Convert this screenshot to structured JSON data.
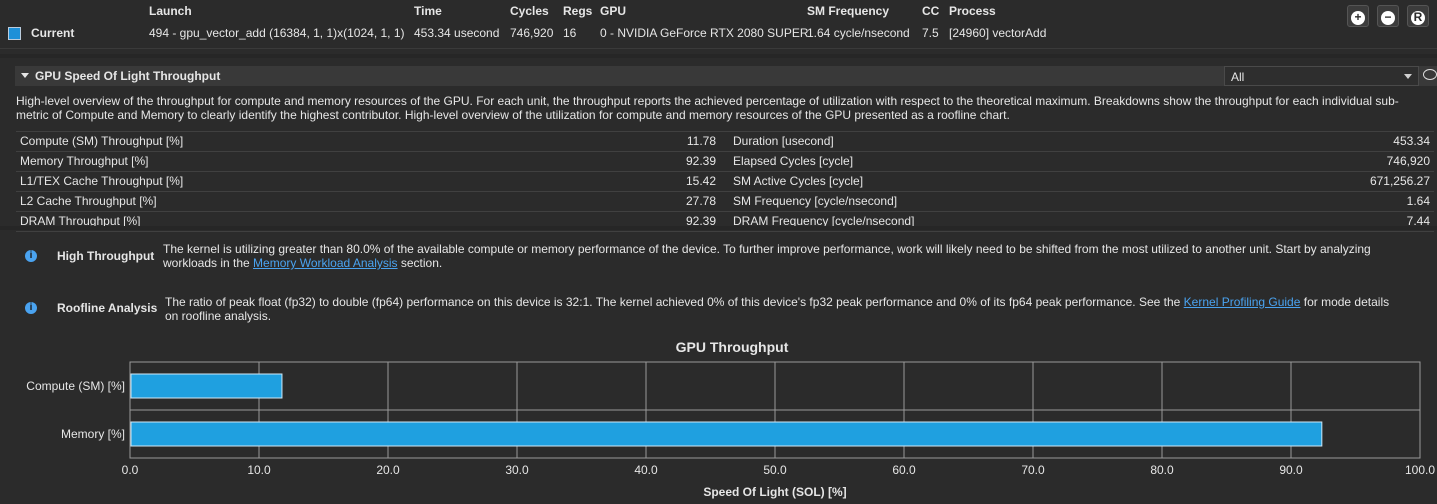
{
  "header": {
    "columns": {
      "launch": "Launch",
      "time": "Time",
      "cycles": "Cycles",
      "regs": "Regs",
      "gpu": "GPU",
      "sm_freq": "SM Frequency",
      "cc": "CC",
      "process": "Process"
    },
    "row": {
      "name": "Current",
      "launch": "494 - gpu_vector_add (16384, 1, 1)x(1024, 1, 1)",
      "time": "453.34 usecond",
      "cycles": "746,920",
      "regs": "16",
      "gpu": "0 - NVIDIA GeForce RTX 2080 SUPER",
      "sm_freq": "1.64 cycle/nsecond",
      "cc": "7.5",
      "process": "[24960] vectorAdd"
    },
    "swatch_color": "#1e90d8",
    "buttons": {
      "add": "+",
      "remove": "−",
      "reset": "R"
    }
  },
  "section": {
    "title": "GPU Speed Of Light Throughput",
    "filter_value": "All",
    "description": "High-level overview of the throughput for compute and memory resources of the GPU. For each unit, the throughput reports the achieved percentage of utilization with respect to the theoretical maximum. Breakdowns show the throughput for each individual sub-metric of Compute and Memory to clearly identify the highest contributor. High-level overview of the utilization for compute and memory resources of the GPU presented as a roofline chart."
  },
  "metrics": [
    {
      "l_name": "Compute (SM) Throughput [%]",
      "l_val": "11.78",
      "r_name": "Duration [usecond]",
      "r_val": "453.34"
    },
    {
      "l_name": "Memory Throughput [%]",
      "l_val": "92.39",
      "r_name": "Elapsed Cycles [cycle]",
      "r_val": "746,920"
    },
    {
      "l_name": "L1/TEX Cache Throughput [%]",
      "l_val": "15.42",
      "r_name": "SM Active Cycles [cycle]",
      "r_val": "671,256.27"
    },
    {
      "l_name": "L2 Cache Throughput [%]",
      "l_val": "27.78",
      "r_name": "SM Frequency [cycle/nsecond]",
      "r_val": "1.64"
    },
    {
      "l_name": "DRAM Throughput [%]",
      "l_val": "92.39",
      "r_name": "DRAM Frequency [cycle/nsecond]",
      "r_val": "7.44"
    }
  ],
  "notes": {
    "high": {
      "title": "High Throughput",
      "text_before": "The kernel is utilizing greater than 80.0% of the available compute or memory performance of the device. To further improve performance, work will likely need to be shifted from the most utilized to another unit. Start by analyzing workloads in the ",
      "link": "Memory Workload Analysis",
      "text_after": " section."
    },
    "roofline": {
      "title": "Roofline Analysis",
      "text_before": "The ratio of peak float (fp32) to double (fp64) performance on this device is 32:1. The kernel achieved 0% of this device's fp32 peak performance and 0% of its fp64 peak performance. See the ",
      "link": "Kernel Profiling Guide",
      "text_after": " for mode details on roofline analysis."
    }
  },
  "chart_data": {
    "type": "bar",
    "orientation": "horizontal",
    "title": "GPU Throughput",
    "xlabel": "Speed Of Light (SOL) [%]",
    "ylabel": "",
    "categories": [
      "Compute (SM) [%]",
      "Memory [%]"
    ],
    "values": [
      11.78,
      92.39
    ],
    "xlim": [
      0,
      100
    ],
    "xticks": [
      "0.0",
      "10.0",
      "20.0",
      "30.0",
      "40.0",
      "50.0",
      "60.0",
      "70.0",
      "80.0",
      "90.0",
      "100.0"
    ],
    "grid": true,
    "bar_color": "#1fa0e0"
  }
}
